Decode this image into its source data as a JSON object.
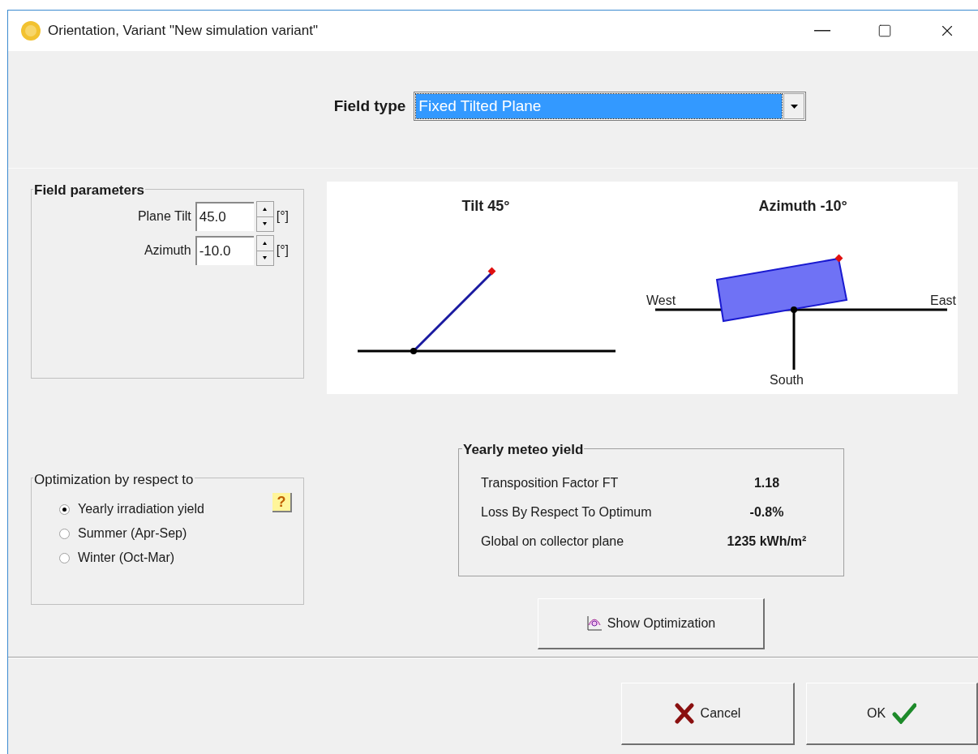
{
  "window": {
    "title": "Orientation, Variant \"New simulation variant\""
  },
  "field_type": {
    "label": "Field type",
    "value": "Fixed Tilted Plane"
  },
  "field_parameters": {
    "title": "Field parameters",
    "params": [
      {
        "label": "Plane Tilt",
        "value": "45.0",
        "unit": "[°]"
      },
      {
        "label": "Azimuth",
        "value": "-10.0",
        "unit": "[°]"
      }
    ]
  },
  "diagram": {
    "tilt_title": "Tilt 45°",
    "azimuth_title": "Azimuth -10°",
    "west": "West",
    "east": "East",
    "south": "South"
  },
  "optimization": {
    "title": "Optimization by respect to",
    "help": "?",
    "options": [
      {
        "label": "Yearly irradiation yield",
        "selected": true
      },
      {
        "label": "Summer (Apr-Sep)",
        "selected": false
      },
      {
        "label": "Winter (Oct-Mar)",
        "selected": false
      }
    ]
  },
  "meteo": {
    "title": "Yearly meteo yield",
    "rows": [
      {
        "label": "Transposition Factor FT",
        "value": "1.18"
      },
      {
        "label": "Loss By Respect To Optimum",
        "value": "-0.8%"
      },
      {
        "label": "Global on collector plane",
        "value": "1235 kWh/m²"
      }
    ]
  },
  "buttons": {
    "show_optimization": "Show Optimization",
    "cancel": "Cancel",
    "ok": "OK"
  }
}
